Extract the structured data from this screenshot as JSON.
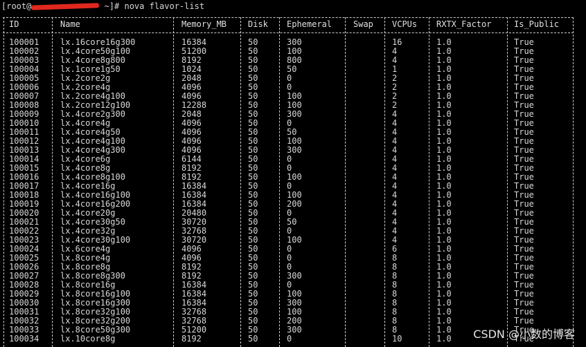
{
  "terminal": {
    "prompt_prefix": "[root@",
    "prompt_suffix": " ~]# ",
    "command": "nova flavor-list"
  },
  "table": {
    "columns": [
      "ID",
      "Name",
      "Memory_MB",
      "Disk",
      "Ephemeral",
      "Swap",
      "VCPUs",
      "RXTX_Factor",
      "Is_Public"
    ],
    "rows": [
      [
        "100001",
        "lx.16core16g300",
        "16384",
        "50",
        "300",
        "",
        "16",
        "1.0",
        "True"
      ],
      [
        "100002",
        "lx.4core50g100",
        "51200",
        "50",
        "100",
        "",
        "4",
        "1.0",
        "True"
      ],
      [
        "100003",
        "lx.4core8g800",
        "8192",
        "50",
        "800",
        "",
        "4",
        "1.0",
        "True"
      ],
      [
        "100004",
        "lx.1core1g50",
        "1024",
        "50",
        "50",
        "",
        "1",
        "1.0",
        "True"
      ],
      [
        "100005",
        "lx.2core2g",
        "2048",
        "50",
        "0",
        "",
        "2",
        "1.0",
        "True"
      ],
      [
        "100006",
        "lx.2core4g",
        "4096",
        "50",
        "0",
        "",
        "2",
        "1.0",
        "True"
      ],
      [
        "100007",
        "lx.2core4g100",
        "4096",
        "50",
        "100",
        "",
        "2",
        "1.0",
        "True"
      ],
      [
        "100008",
        "lx.2core12g100",
        "12288",
        "50",
        "100",
        "",
        "2",
        "1.0",
        "True"
      ],
      [
        "100009",
        "lx.4core2g300",
        "2048",
        "50",
        "300",
        "",
        "4",
        "1.0",
        "True"
      ],
      [
        "100010",
        "lx.4core4g",
        "4096",
        "50",
        "0",
        "",
        "4",
        "1.0",
        "True"
      ],
      [
        "100011",
        "lx.4core4g50",
        "4096",
        "50",
        "50",
        "",
        "4",
        "1.0",
        "True"
      ],
      [
        "100012",
        "lx.4core4g100",
        "4096",
        "50",
        "100",
        "",
        "4",
        "1.0",
        "True"
      ],
      [
        "100013",
        "lx.4core4g300",
        "4096",
        "50",
        "300",
        "",
        "4",
        "1.0",
        "True"
      ],
      [
        "100014",
        "lx.4core6g",
        "6144",
        "50",
        "0",
        "",
        "4",
        "1.0",
        "True"
      ],
      [
        "100015",
        "lx.4core8g",
        "8192",
        "50",
        "0",
        "",
        "4",
        "1.0",
        "True"
      ],
      [
        "100016",
        "lx.4core8g100",
        "8192",
        "50",
        "100",
        "",
        "4",
        "1.0",
        "True"
      ],
      [
        "100017",
        "lx.4core16g",
        "16384",
        "50",
        "0",
        "",
        "4",
        "1.0",
        "True"
      ],
      [
        "100018",
        "lx.4core16g100",
        "16384",
        "50",
        "100",
        "",
        "4",
        "1.0",
        "True"
      ],
      [
        "100019",
        "lx.4core16g200",
        "16384",
        "50",
        "200",
        "",
        "4",
        "1.0",
        "True"
      ],
      [
        "100020",
        "lx.4core20g",
        "20480",
        "50",
        "0",
        "",
        "4",
        "1.0",
        "True"
      ],
      [
        "100021",
        "lx.4core30g50",
        "30720",
        "50",
        "50",
        "",
        "4",
        "1.0",
        "True"
      ],
      [
        "100022",
        "lx.4core32g",
        "32768",
        "50",
        "0",
        "",
        "4",
        "1.0",
        "True"
      ],
      [
        "100023",
        "lx.4core30g100",
        "30720",
        "50",
        "100",
        "",
        "4",
        "1.0",
        "True"
      ],
      [
        "100024",
        "lx.6core4g",
        "4096",
        "50",
        "0",
        "",
        "6",
        "1.0",
        "True"
      ],
      [
        "100025",
        "lx.8core4g",
        "4096",
        "50",
        "0",
        "",
        "8",
        "1.0",
        "True"
      ],
      [
        "100026",
        "lx.8core8g",
        "8192",
        "50",
        "0",
        "",
        "8",
        "1.0",
        "True"
      ],
      [
        "100027",
        "lx.8core8g300",
        "8192",
        "50",
        "300",
        "",
        "8",
        "1.0",
        "True"
      ],
      [
        "100028",
        "lx.8core16g",
        "16384",
        "50",
        "0",
        "",
        "8",
        "1.0",
        "True"
      ],
      [
        "100029",
        "lx.8core16g100",
        "16384",
        "50",
        "100",
        "",
        "8",
        "1.0",
        "True"
      ],
      [
        "100030",
        "lx.8core16g300",
        "16384",
        "50",
        "300",
        "",
        "8",
        "1.0",
        "True"
      ],
      [
        "100031",
        "lx.8core32g100",
        "32768",
        "50",
        "100",
        "",
        "8",
        "1.0",
        "True"
      ],
      [
        "100032",
        "lx.8core32g200",
        "32768",
        "50",
        "200",
        "",
        "8",
        "1.0",
        "True"
      ],
      [
        "100033",
        "lx.8core50g300",
        "51200",
        "50",
        "300",
        "",
        "8",
        "1.0",
        "True"
      ],
      [
        "100034",
        "lx.10core8g",
        "8192",
        "50",
        "0",
        "",
        "10",
        "1.0",
        "True"
      ]
    ]
  },
  "watermark": "CSDN @小数的博客"
}
